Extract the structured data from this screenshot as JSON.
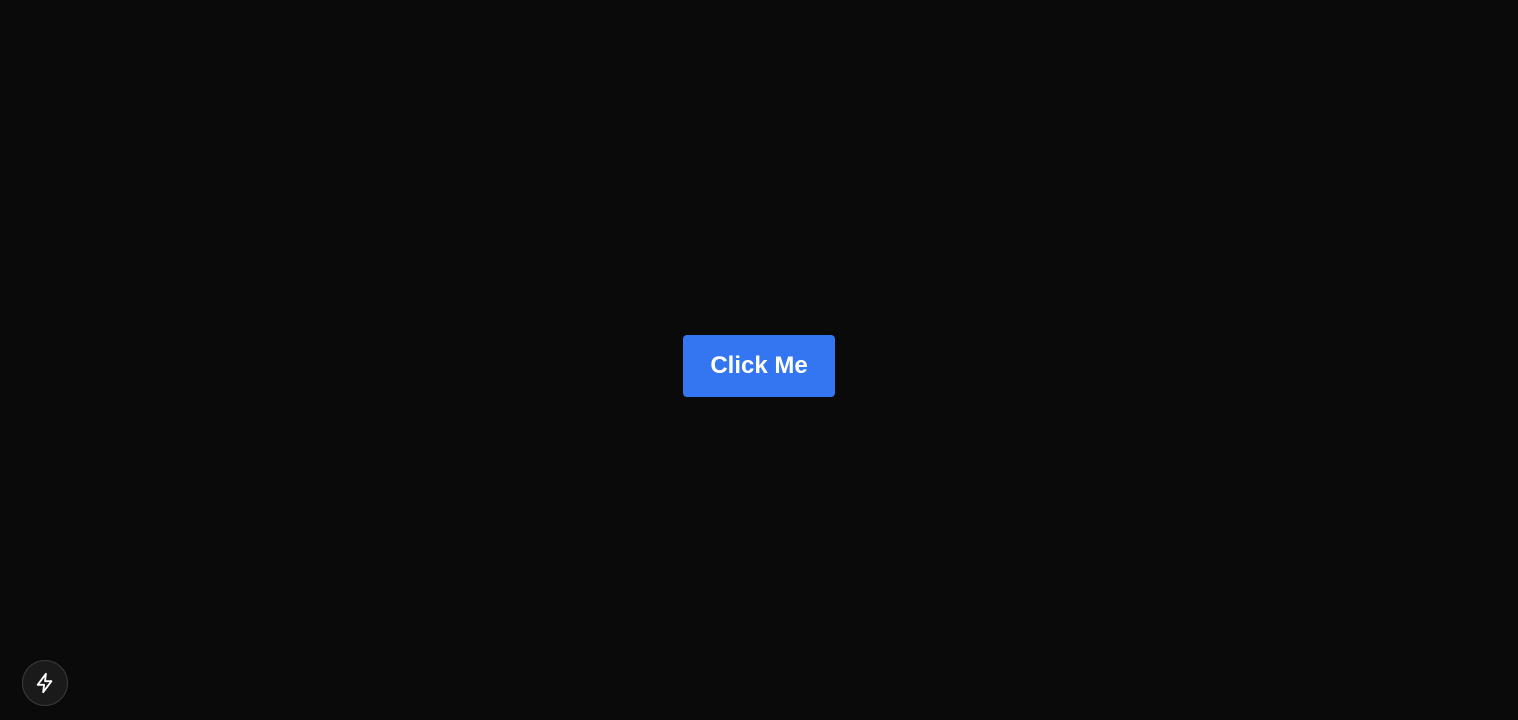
{
  "main": {
    "button_label": "Click Me",
    "button_color": "#3476f1",
    "background_color": "#0a0a0b"
  },
  "floating_action": {
    "icon": "lightning-bolt-icon"
  }
}
